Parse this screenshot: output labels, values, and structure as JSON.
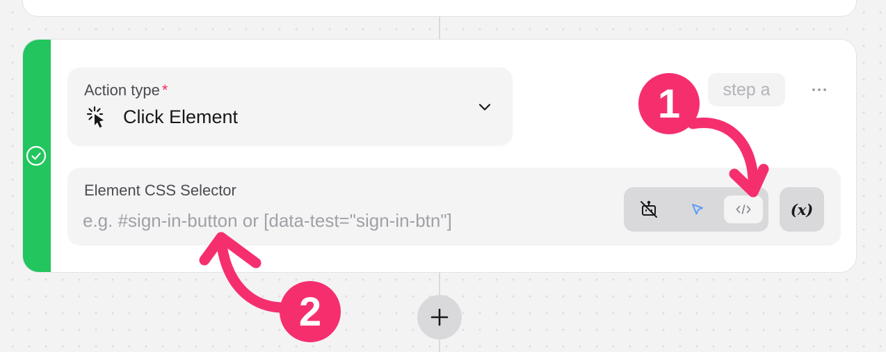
{
  "action": {
    "label": "Action type",
    "required_mark": "*",
    "value": "Click Element",
    "icon": "click-cursor-icon",
    "dropdown_icon": "chevron-down-icon"
  },
  "step": {
    "name_placeholder": "step a",
    "more_icon": "more-horizontal-icon",
    "status_icon": "check-circle-icon"
  },
  "selector": {
    "label": "Element CSS Selector",
    "value": "",
    "placeholder": "e.g. #sign-in-button or [data-test=\"sign-in-btn\"]",
    "modes": [
      {
        "name": "disable-robot",
        "icon": "robot-off-icon"
      },
      {
        "name": "pick-element",
        "icon": "cursor-arrow-icon"
      },
      {
        "name": "css-code",
        "icon": "code-icon",
        "active": true
      }
    ],
    "variable_button_label": "(x)"
  },
  "add_step": {
    "icon": "plus-icon"
  },
  "annotations": [
    "1",
    "2"
  ],
  "colors": {
    "status_bar": "#22c55e",
    "annotation": "#f52f6e",
    "required": "#ef2d56",
    "pick_icon": "#5b9cf6"
  }
}
